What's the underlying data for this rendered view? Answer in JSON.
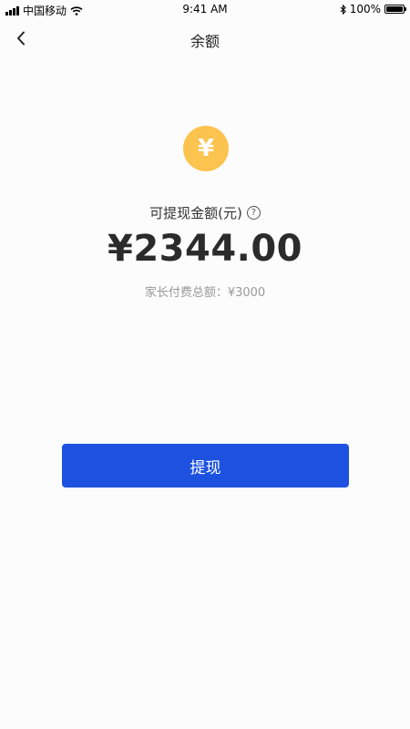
{
  "status_bar": {
    "carrier": "中国移动",
    "time": "9:41 AM",
    "battery_percent": "100%"
  },
  "nav": {
    "title": "余额"
  },
  "balance": {
    "currency_symbol": "¥",
    "label": "可提现金额(元)",
    "amount": "¥2344.00",
    "parent_total": "家长付费总额：¥3000"
  },
  "actions": {
    "withdraw_label": "提现"
  },
  "colors": {
    "coin": "#fcc34f",
    "primary_button": "#1d52e0",
    "secondary_text": "#999999"
  }
}
